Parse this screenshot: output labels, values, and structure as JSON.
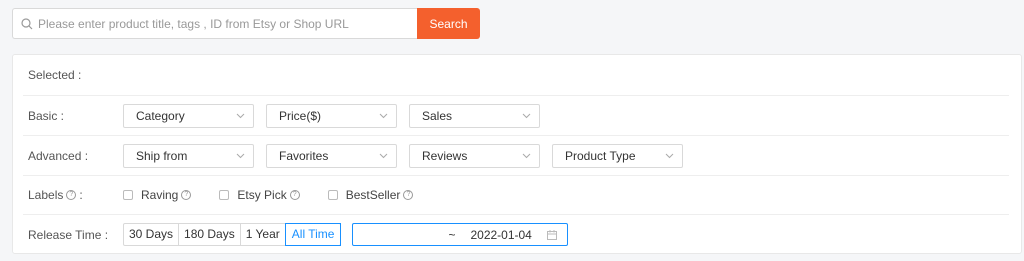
{
  "search": {
    "placeholder": "Please enter product title, tags , ID from Etsy or Shop URL",
    "button_label": "Search"
  },
  "filters": {
    "selected_label": "Selected :",
    "basic": {
      "label": "Basic :",
      "selects": [
        "Category",
        "Price($)",
        "Sales"
      ]
    },
    "advanced": {
      "label": "Advanced :",
      "selects": [
        "Ship from",
        "Favorites",
        "Reviews",
        "Product Type"
      ]
    },
    "labels": {
      "label": "Labels",
      "colon": ":",
      "options": [
        "Raving",
        "Etsy Pick",
        "BestSeller"
      ]
    },
    "release_time": {
      "label": "Release Time :",
      "options": [
        "30 Days",
        "180 Days",
        "1 Year",
        "All Time"
      ],
      "active": "All Time",
      "range_separator": "~",
      "range_end": "2022-01-04"
    }
  },
  "colors": {
    "accent": "#f4602d",
    "active": "#1890ff"
  }
}
